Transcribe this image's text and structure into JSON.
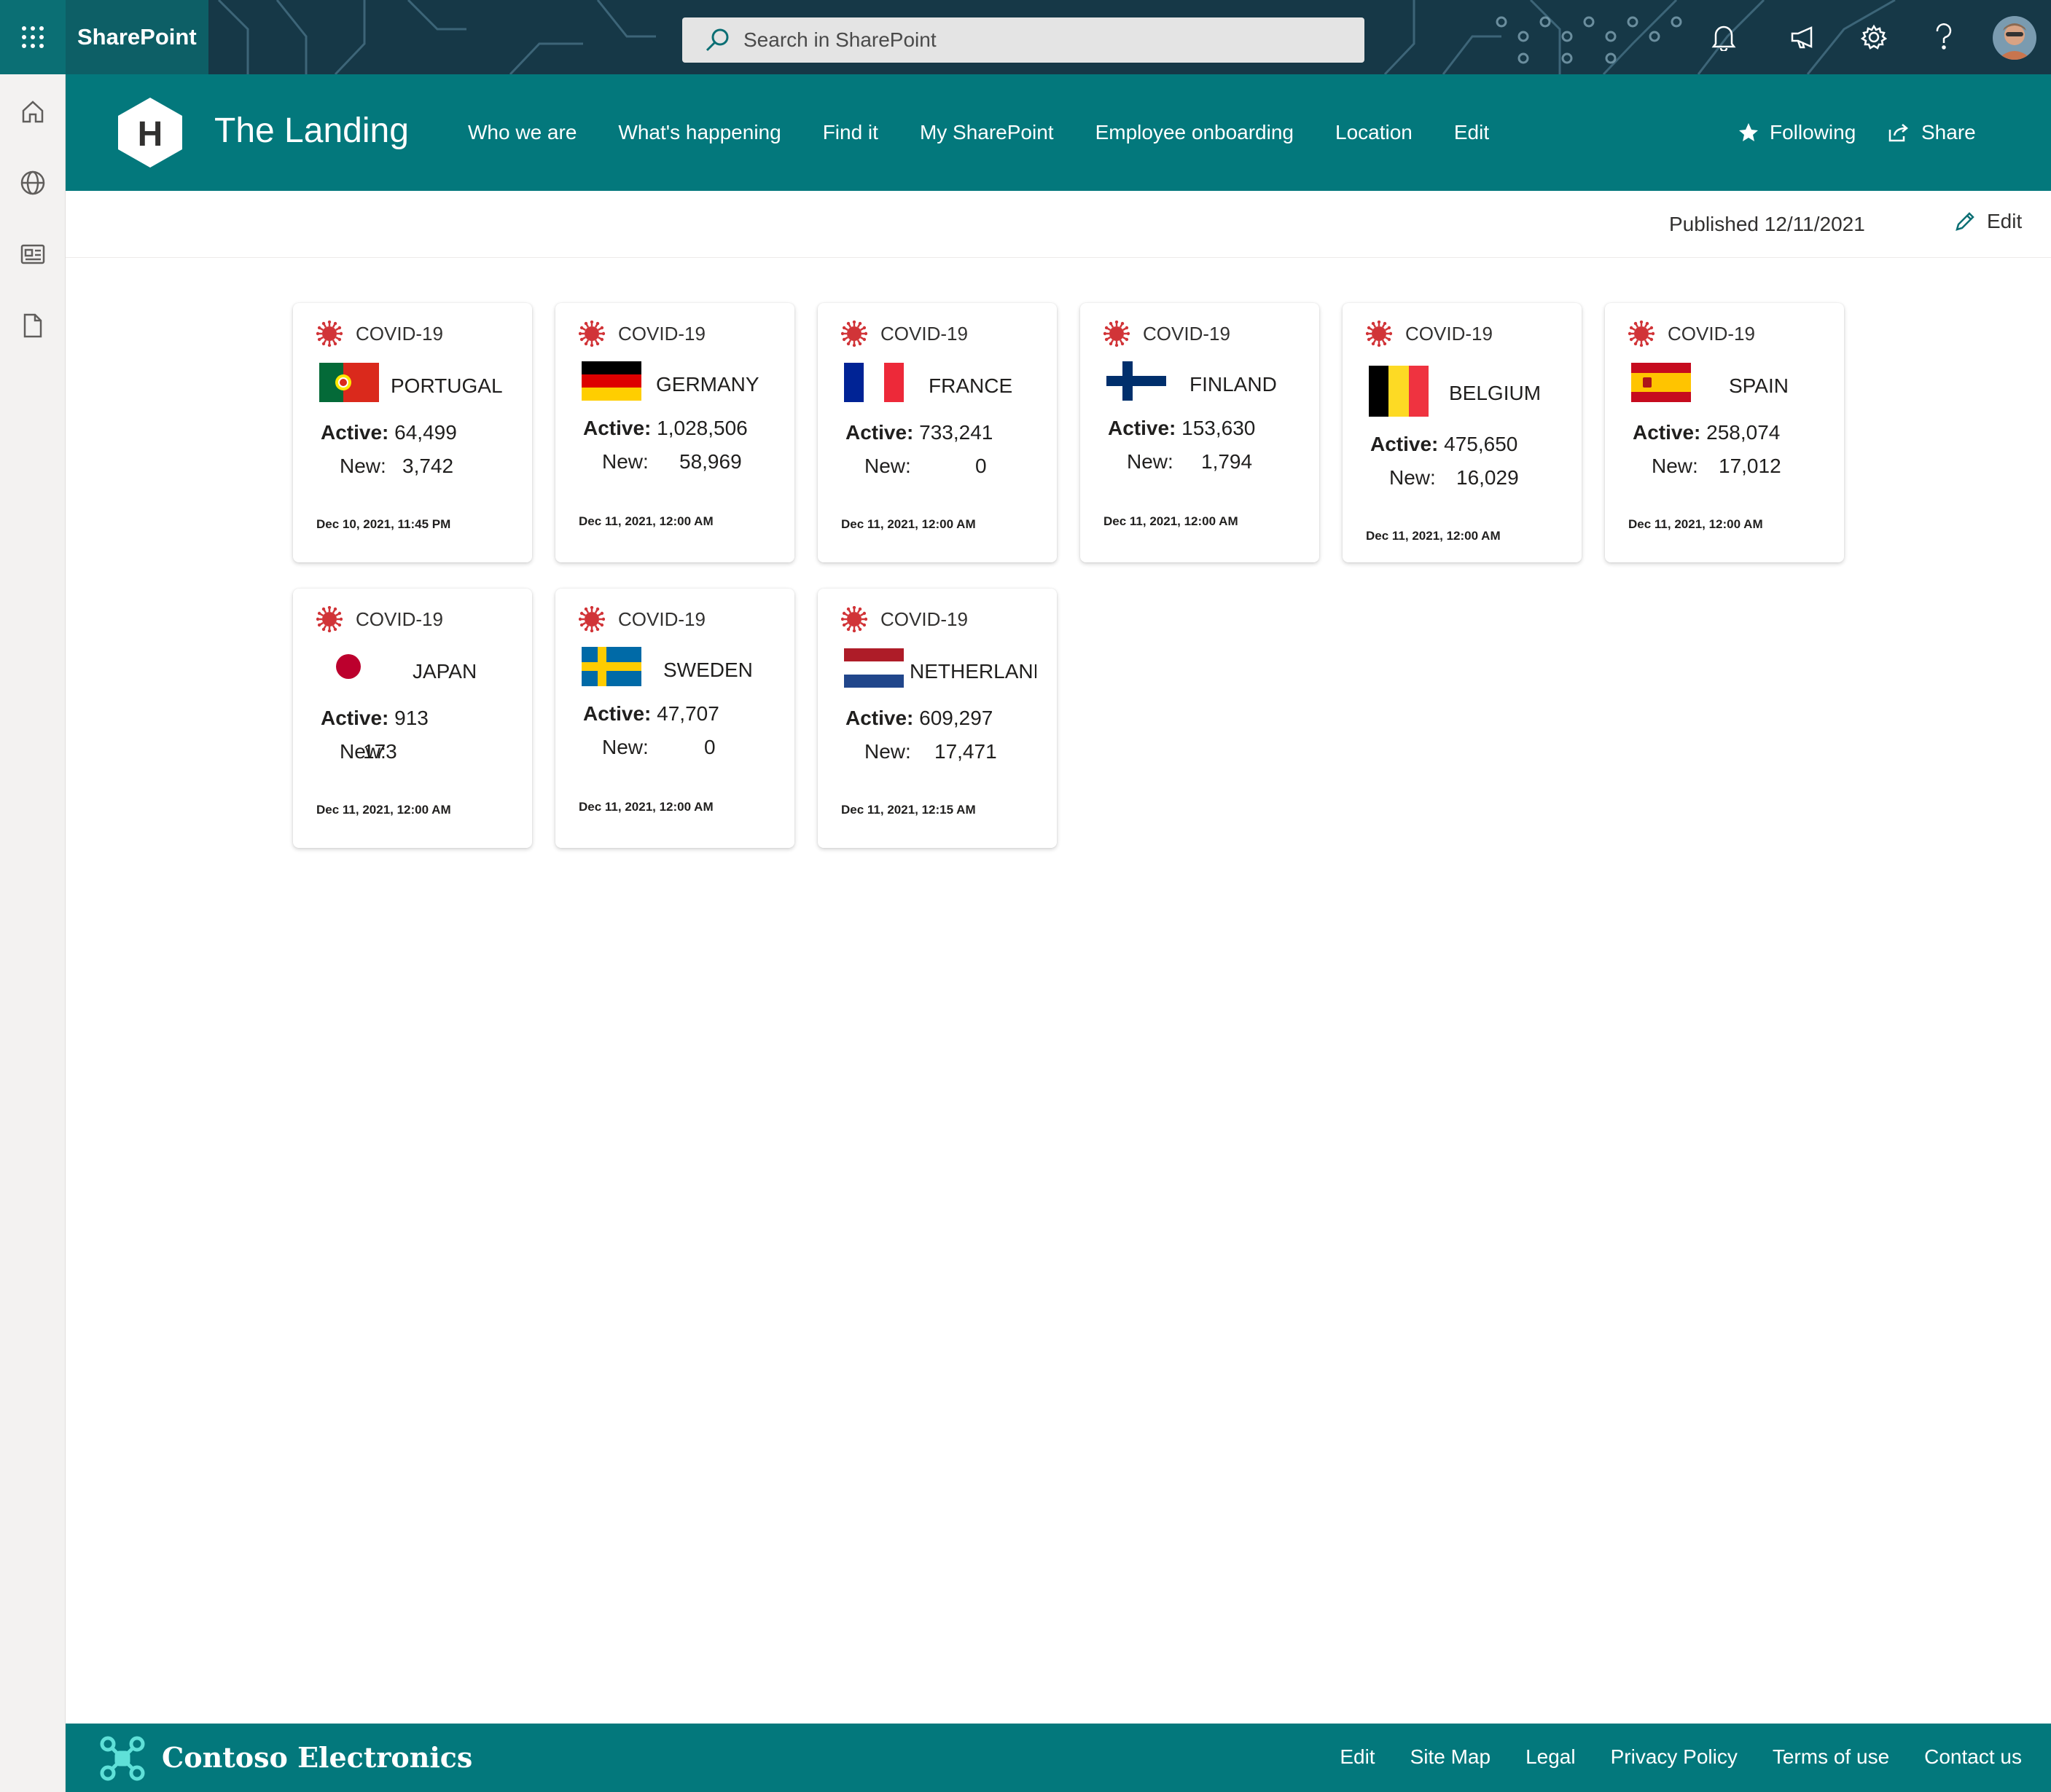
{
  "suitebar": {
    "brand": "SharePoint",
    "search_placeholder": "Search in SharePoint"
  },
  "site": {
    "logo_letter": "H",
    "title": "The Landing",
    "nav": [
      "Who we are",
      "What's happening",
      "Find it",
      "My SharePoint",
      "Employee onboarding",
      "Location",
      "Edit"
    ],
    "following": "Following",
    "share": "Share"
  },
  "command": {
    "published": "Published 12/11/2021",
    "edit": "Edit"
  },
  "cards": [
    {
      "label": "COVID-19",
      "country": "PORTUGAL",
      "active_label": "Active:",
      "active": "64,499",
      "new_label": "New:",
      "new": "3,742",
      "date": "Dec 10, 2021, 11:45 PM"
    },
    {
      "label": "COVID-19",
      "country": "GERMANY",
      "active_label": "Active:",
      "active": "1,028,506",
      "new_label": "New:",
      "new": "58,969",
      "date": "Dec 11, 2021, 12:00 AM"
    },
    {
      "label": "COVID-19",
      "country": "FRANCE",
      "active_label": "Active:",
      "active": "733,241",
      "new_label": "New:",
      "new": "0",
      "date": "Dec 11, 2021, 12:00 AM"
    },
    {
      "label": "COVID-19",
      "country": "FINLAND",
      "active_label": "Active:",
      "active": "153,630",
      "new_label": "New:",
      "new": "1,794",
      "date": "Dec 11, 2021, 12:00 AM"
    },
    {
      "label": "COVID-19",
      "country": "BELGIUM",
      "active_label": "Active:",
      "active": "475,650",
      "new_label": "New:",
      "new": "16,029",
      "date": "Dec 11, 2021, 12:00 AM"
    },
    {
      "label": "COVID-19",
      "country": "SPAIN",
      "active_label": "Active:",
      "active": "258,074",
      "new_label": "New:",
      "new": "17,012",
      "date": "Dec 11, 2021, 12:00 AM"
    },
    {
      "label": "COVID-19",
      "country": "JAPAN",
      "active_label": "Active:",
      "active": "913",
      "new_label": "New:",
      "new": "173",
      "date": "Dec 11, 2021, 12:00 AM"
    },
    {
      "label": "COVID-19",
      "country": "SWEDEN",
      "active_label": "Active:",
      "active": "47,707",
      "new_label": "New:",
      "new": "0",
      "date": "Dec 11, 2021, 12:00 AM"
    },
    {
      "label": "COVID-19",
      "country": "NETHERLAND",
      "active_label": "Active:",
      "active": "609,297",
      "new_label": "New:",
      "new": "17,471",
      "date": "Dec 11, 2021, 12:15 AM"
    }
  ],
  "footer": {
    "brand": "Contoso Electronics",
    "links": [
      "Edit",
      "Site Map",
      "Legal",
      "Privacy Policy",
      "Terms of use",
      "Contact us"
    ]
  },
  "colors": {
    "theme": "#03787c",
    "suitebar": "#1a3d4f",
    "virus": "#d13438"
  },
  "icons": [
    "waffle-icon",
    "search-icon",
    "bell-icon",
    "megaphone-icon",
    "gear-icon",
    "help-icon",
    "home-icon",
    "globe-icon",
    "news-icon",
    "document-icon",
    "star-icon",
    "share-icon",
    "pencil-icon",
    "expand-icon",
    "virus-icon",
    "contoso-logo-icon"
  ]
}
